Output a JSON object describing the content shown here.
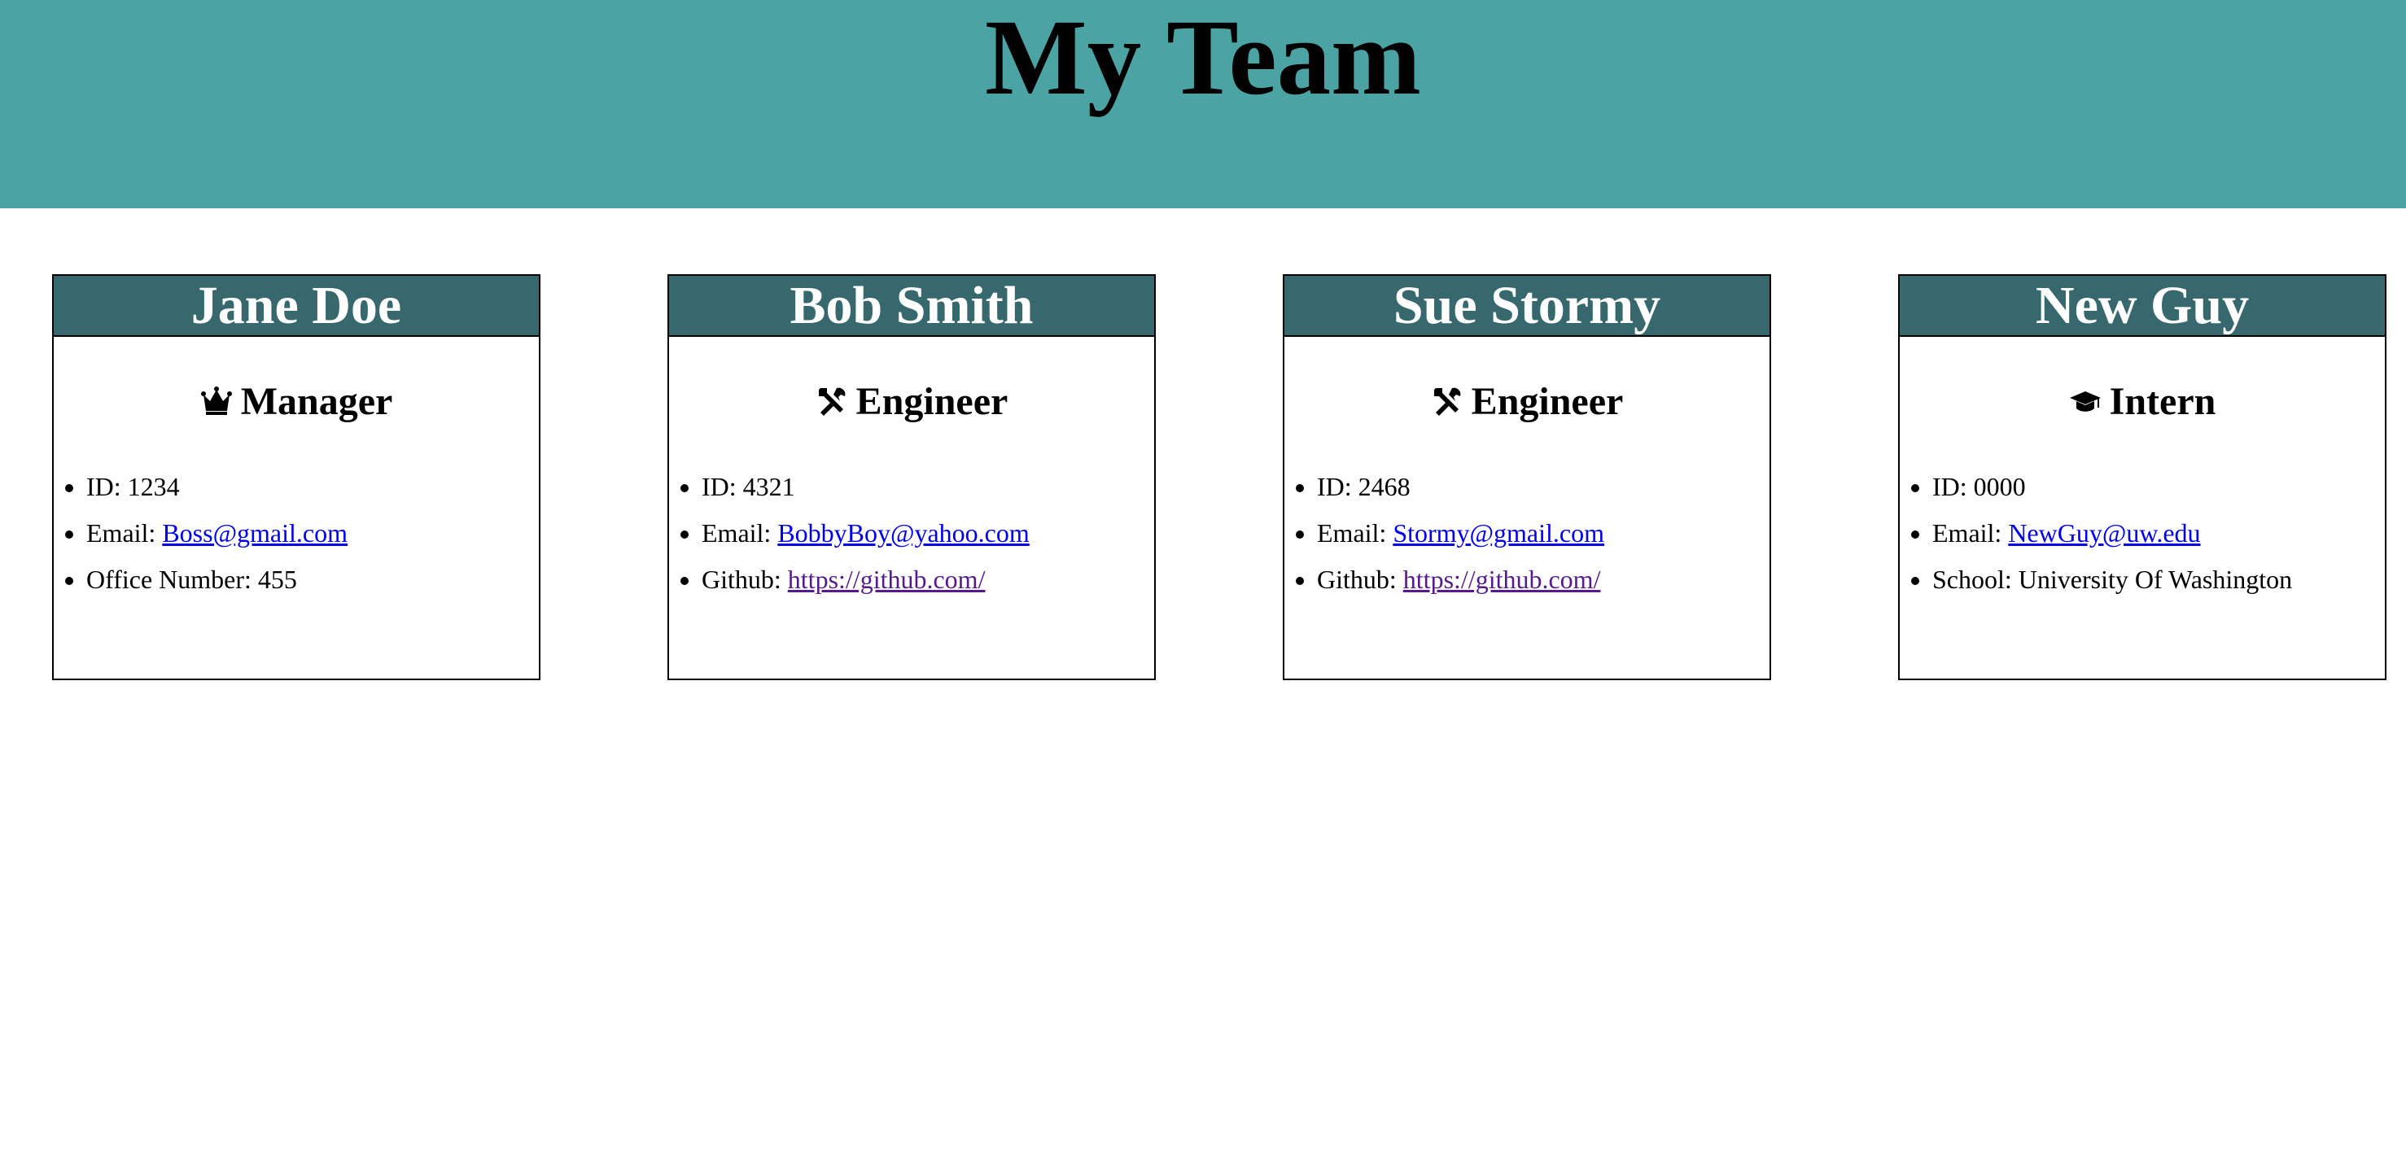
{
  "header": {
    "title": "My Team",
    "background": "#4ba4a3"
  },
  "card_header_color": "#36686d",
  "team": [
    {
      "name": "Jane Doe",
      "role": "Manager",
      "icon": "crown-icon",
      "id_label": "ID: ",
      "id": "1234",
      "email_label": "Email: ",
      "email": "Boss@gmail.com",
      "extra_label": "Office Number: ",
      "extra": "455"
    },
    {
      "name": "Bob Smith",
      "role": "Engineer",
      "icon": "tools-icon",
      "id_label": "ID: ",
      "id": "4321",
      "email_label": "Email: ",
      "email": "BobbyBoy@yahoo.com",
      "extra_label": "Github: ",
      "extra": "https://github.com/"
    },
    {
      "name": "Sue Stormy",
      "role": "Engineer",
      "icon": "tools-icon",
      "id_label": "ID: ",
      "id": "2468",
      "email_label": "Email: ",
      "email": "Stormy@gmail.com",
      "extra_label": "Github: ",
      "extra": "https://github.com/"
    },
    {
      "name": "New Guy",
      "role": "Intern",
      "icon": "graduation-cap-icon",
      "id_label": "ID: ",
      "id": "0000",
      "email_label": "Email: ",
      "email": "NewGuy@uw.edu",
      "extra_label": "School: ",
      "extra": "University Of Washington"
    }
  ]
}
